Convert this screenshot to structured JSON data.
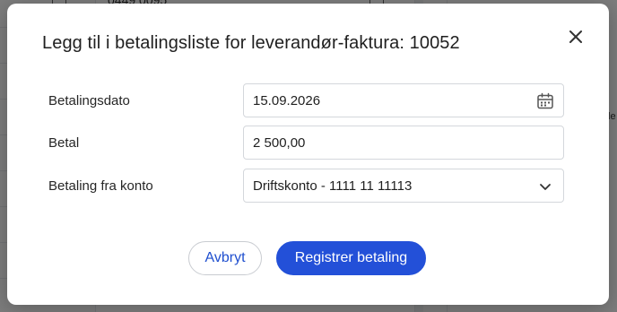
{
  "background": {
    "partial_value": "0449 0095",
    "right_partial": "le"
  },
  "dialog": {
    "title": "Legg til i betalingsliste for leverandør-faktura: 10052",
    "close_icon": "close-icon"
  },
  "form": {
    "payment_date": {
      "label": "Betalingsdato",
      "value": "15.09.2026",
      "icon": "calendar-icon"
    },
    "amount": {
      "label": "Betal",
      "value": "2 500,00"
    },
    "from_account": {
      "label": "Betaling fra konto",
      "value": "Driftskonto - 1111 11 11113",
      "icon": "chevron-down-icon"
    }
  },
  "actions": {
    "cancel_label": "Avbryt",
    "submit_label": "Registrer betaling"
  },
  "colors": {
    "primary": "#2350d8",
    "cancel_text": "#1f4fcf",
    "backdrop": "rgba(0,0,0,0.5)"
  }
}
